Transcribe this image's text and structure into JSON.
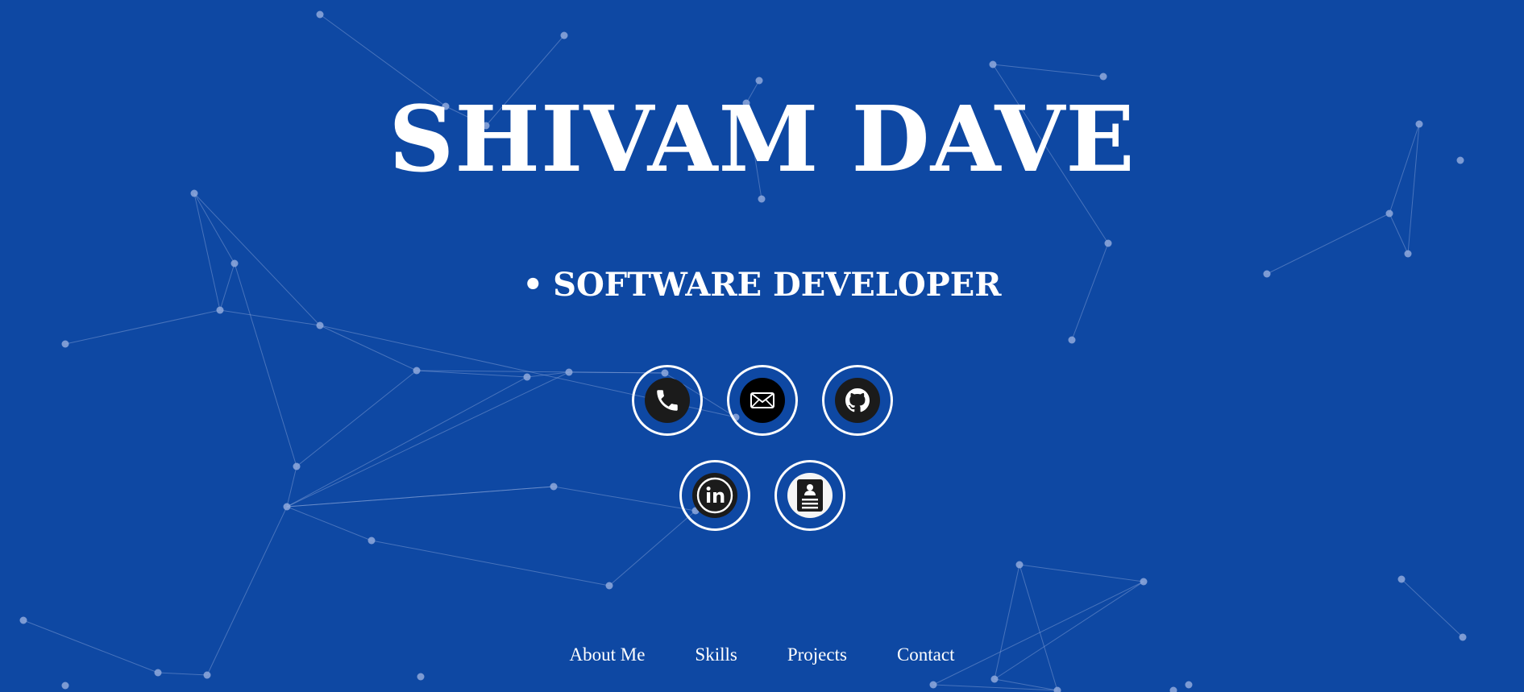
{
  "hero": {
    "name": "SHIVAM DAVE",
    "role_bullet": "•",
    "role": "SOFTWARE DEVELOPER"
  },
  "contact_icons": [
    {
      "icon": "phone-icon"
    },
    {
      "icon": "email-icon"
    },
    {
      "icon": "github-icon"
    },
    {
      "icon": "linkedin-icon"
    },
    {
      "icon": "resume-icon"
    }
  ],
  "nav": {
    "items": [
      "About Me",
      "Skills",
      "Projects",
      "Contact"
    ]
  },
  "colors": {
    "background": "#0e48a3",
    "text": "#ffffff",
    "icon_fill": "#1b1b1b",
    "network": "#8fa9dc"
  }
}
